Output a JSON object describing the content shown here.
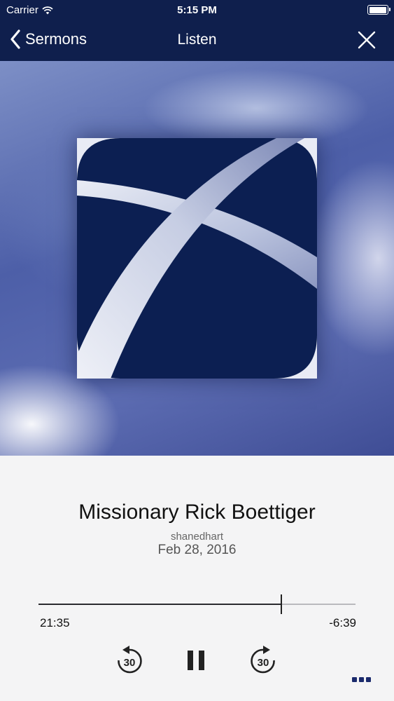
{
  "status_bar": {
    "carrier": "Carrier",
    "time": "5:15 PM"
  },
  "nav": {
    "back_label": "Sermons",
    "title": "Listen"
  },
  "track": {
    "title": "Missionary Rick Boettiger",
    "author": "shanedhart",
    "date": "Feb 28, 2016"
  },
  "playback": {
    "elapsed": "21:35",
    "remaining": "-6:39",
    "progress_fraction": 0.765
  },
  "controls": {
    "rewind_seconds": "30",
    "forward_seconds": "30"
  },
  "colors": {
    "navy": "#0f1f4d",
    "accent": "#1a2a6c"
  }
}
